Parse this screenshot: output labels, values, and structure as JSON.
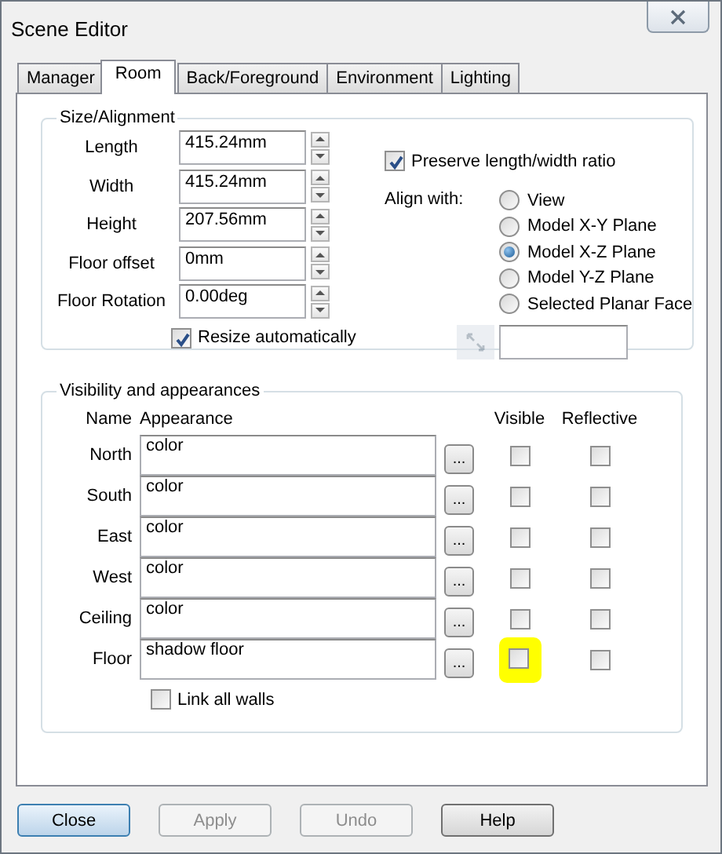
{
  "window": {
    "title": "Scene Editor"
  },
  "tabs": [
    {
      "label": "Manager",
      "selected": false
    },
    {
      "label": "Room",
      "selected": true
    },
    {
      "label": "Back/Foreground",
      "selected": false
    },
    {
      "label": "Environment",
      "selected": false
    },
    {
      "label": "Lighting",
      "selected": false
    }
  ],
  "size_alignment": {
    "title": "Size/Alignment",
    "fields": [
      {
        "label": "Length",
        "value": "415.24mm"
      },
      {
        "label": "Width",
        "value": "415.24mm"
      },
      {
        "label": "Height",
        "value": "207.56mm"
      },
      {
        "label": "Floor offset",
        "value": "0mm"
      },
      {
        "label": "Floor Rotation",
        "value": "0.00deg"
      }
    ],
    "resize_automatically": {
      "label": "Resize automatically",
      "checked": true
    },
    "preserve_ratio": {
      "label": "Preserve length/width ratio",
      "checked": true
    },
    "align_with": {
      "label": "Align with:",
      "options": [
        {
          "label": "View",
          "selected": false
        },
        {
          "label": "Model X-Y Plane",
          "selected": false
        },
        {
          "label": "Model X-Z Plane",
          "selected": true
        },
        {
          "label": "Model Y-Z Plane",
          "selected": false
        },
        {
          "label": "Selected Planar Face",
          "selected": false
        }
      ]
    },
    "pick_button": {
      "disabled": true
    }
  },
  "visibility": {
    "title": "Visibility and appearances",
    "columns": [
      "Name",
      "Appearance",
      "Visible",
      "Reflective"
    ],
    "rows": [
      {
        "name": "North",
        "appearance": "color",
        "button": "...",
        "visible": false,
        "reflective": false,
        "highlighted": false
      },
      {
        "name": "South",
        "appearance": "color",
        "button": "...",
        "visible": false,
        "reflective": false,
        "highlighted": false
      },
      {
        "name": "East",
        "appearance": "color",
        "button": "...",
        "visible": false,
        "reflective": false,
        "highlighted": false
      },
      {
        "name": "West",
        "appearance": "color",
        "button": "...",
        "visible": false,
        "reflective": false,
        "highlighted": false
      },
      {
        "name": "Ceiling",
        "appearance": "color",
        "button": "...",
        "visible": false,
        "reflective": false,
        "highlighted": false
      },
      {
        "name": "Floor",
        "appearance": "shadow floor",
        "button": "...",
        "visible": false,
        "reflective": false,
        "highlighted": true
      }
    ],
    "link_all_walls": {
      "label": "Link all walls",
      "checked": false
    }
  },
  "buttons": [
    {
      "label": "Close",
      "disabled": false,
      "default": true
    },
    {
      "label": "Apply",
      "disabled": true,
      "default": false
    },
    {
      "label": "Undo",
      "disabled": true,
      "default": false
    },
    {
      "label": "Help",
      "disabled": false,
      "default": false
    }
  ]
}
